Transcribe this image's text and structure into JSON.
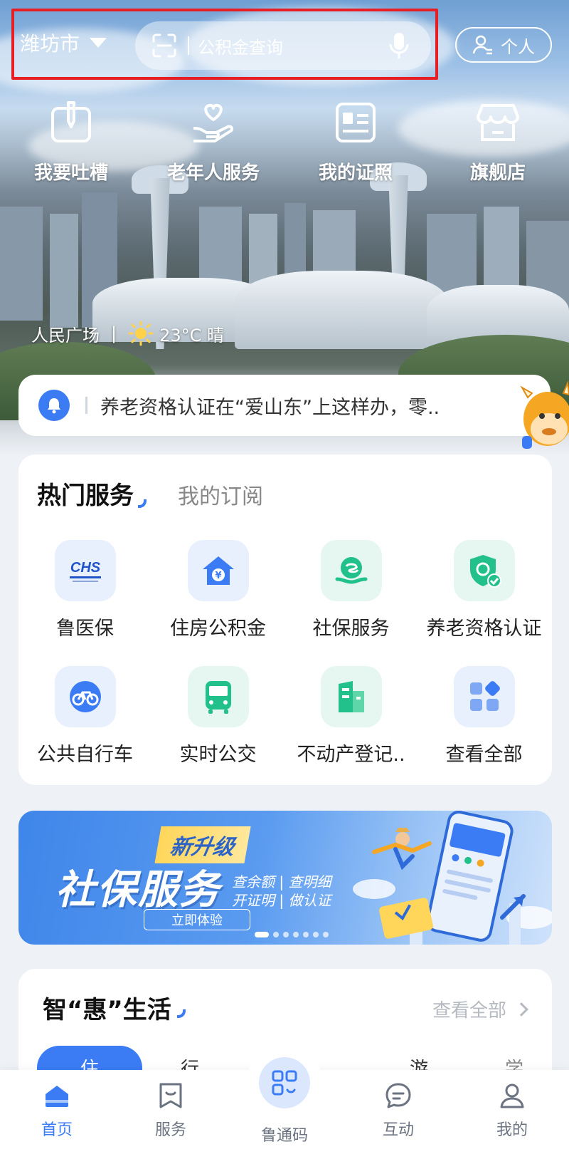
{
  "header": {
    "city": "潍坊市",
    "search_placeholder": "公积金查询",
    "personal_label": "个人"
  },
  "quick_actions": [
    {
      "label": "我要吐槽",
      "icon": "feedback-pen-icon"
    },
    {
      "label": "老年人服务",
      "icon": "heart-hand-icon"
    },
    {
      "label": "我的证照",
      "icon": "id-card-icon"
    },
    {
      "label": "旗舰店",
      "icon": "store-icon"
    }
  ],
  "location": {
    "place": "人民广场",
    "separator": "|",
    "weather": "23°C 晴"
  },
  "notice": {
    "text": "养老资格认证在“爱山东”上这样办，零.."
  },
  "services": {
    "tab_active": "热门服务",
    "tab_inactive": "我的订阅",
    "chs_text": "CHS",
    "items": [
      {
        "label": "鲁医保",
        "icon": "chs-medical-insurance-icon"
      },
      {
        "label": "住房公积金",
        "icon": "housing-fund-icon"
      },
      {
        "label": "社保服务",
        "icon": "social-security-icon"
      },
      {
        "label": "养老资格认证",
        "icon": "pension-shield-icon"
      },
      {
        "label": "公共自行车",
        "icon": "bicycle-icon"
      },
      {
        "label": "实时公交",
        "icon": "bus-icon"
      },
      {
        "label": "不动产登记..",
        "icon": "real-estate-icon"
      },
      {
        "label": "查看全部",
        "icon": "grid-all-icon"
      }
    ]
  },
  "banner": {
    "tag": "新升级",
    "title": "社保服务",
    "sub_line1": "查余额 | 查明细",
    "sub_line2": "开证明 | 做认证",
    "button": "立即体验",
    "slide_count": 7,
    "active_slide": 0
  },
  "smart_life": {
    "title": "智“惠”生活",
    "more": "查看全部",
    "tabs": [
      "住",
      "行",
      "游",
      "学"
    ]
  },
  "bottom_nav": {
    "items": [
      {
        "label": "首页",
        "icon": "home-icon",
        "active": true
      },
      {
        "label": "服务",
        "icon": "bookmark-icon",
        "active": false
      },
      {
        "label": "鲁通码",
        "icon": "qr-code-icon",
        "active": false
      },
      {
        "label": "互动",
        "icon": "chat-icon",
        "active": false
      },
      {
        "label": "我的",
        "icon": "user-icon",
        "active": false
      }
    ]
  },
  "colors": {
    "accent": "#3b7cf5",
    "highlight_border": "#e81e25",
    "green_service": "#22c08a"
  }
}
